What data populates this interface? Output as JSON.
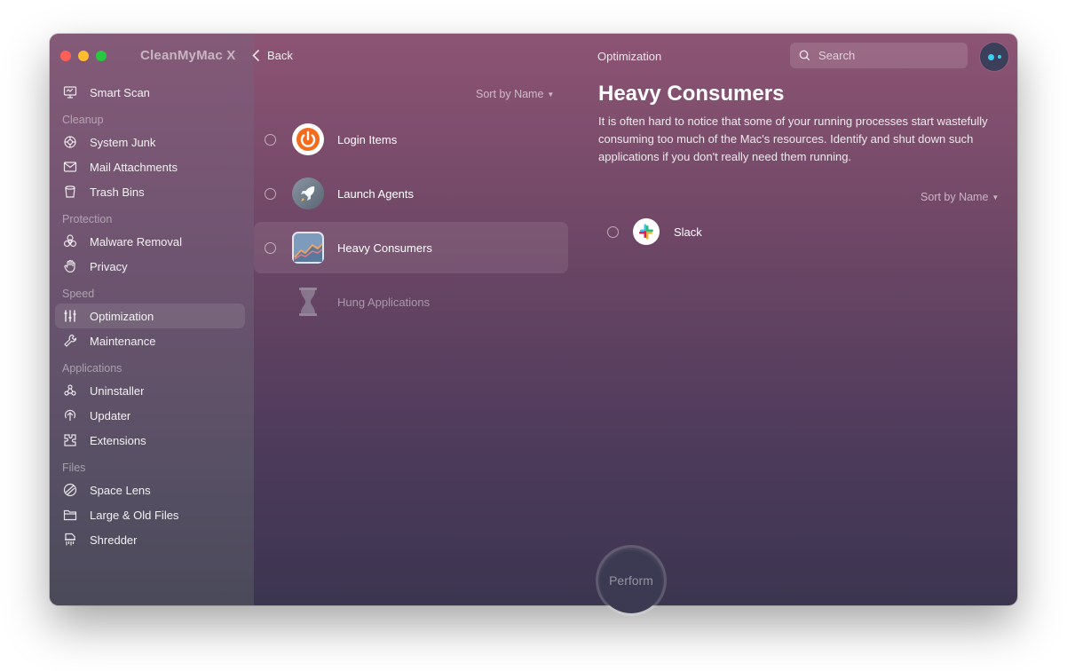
{
  "app": {
    "title": "CleanMyMac X"
  },
  "header": {
    "back_label": "Back",
    "title": "Optimization"
  },
  "search": {
    "placeholder": "Search"
  },
  "sidebar": {
    "top_item": {
      "label": "Smart Scan",
      "icon": "monitor-scan-icon"
    },
    "sections": [
      {
        "title": "Cleanup",
        "items": [
          {
            "label": "System Junk",
            "icon": "system-junk-icon"
          },
          {
            "label": "Mail Attachments",
            "icon": "mail-icon"
          },
          {
            "label": "Trash Bins",
            "icon": "trash-icon"
          }
        ]
      },
      {
        "title": "Protection",
        "items": [
          {
            "label": "Malware Removal",
            "icon": "biohazard-icon"
          },
          {
            "label": "Privacy",
            "icon": "hand-icon"
          }
        ]
      },
      {
        "title": "Speed",
        "items": [
          {
            "label": "Optimization",
            "icon": "sliders-icon",
            "active": true
          },
          {
            "label": "Maintenance",
            "icon": "wrench-icon"
          }
        ]
      },
      {
        "title": "Applications",
        "items": [
          {
            "label": "Uninstaller",
            "icon": "uninstaller-icon"
          },
          {
            "label": "Updater",
            "icon": "updater-icon"
          },
          {
            "label": "Extensions",
            "icon": "extensions-icon"
          }
        ]
      },
      {
        "title": "Files",
        "items": [
          {
            "label": "Space Lens",
            "icon": "space-lens-icon"
          },
          {
            "label": "Large & Old Files",
            "icon": "folder-icon"
          },
          {
            "label": "Shredder",
            "icon": "shredder-icon"
          }
        ]
      }
    ]
  },
  "list": {
    "sort_label": "Sort by Name",
    "items": [
      {
        "label": "Login Items",
        "icon": "power-icon"
      },
      {
        "label": "Launch Agents",
        "icon": "rocket-icon"
      },
      {
        "label": "Heavy Consumers",
        "icon": "chart-icon",
        "selected": true
      },
      {
        "label": "Hung Applications",
        "icon": "hourglass-icon",
        "disabled": true
      }
    ]
  },
  "detail": {
    "title": "Heavy Consumers",
    "description": "It is often hard to notice that some of your running processes start wastefully consuming too much of the Mac's resources. Identify and shut down such applications if you don't really need them running.",
    "sort_label": "Sort by Name",
    "apps": [
      {
        "label": "Slack",
        "icon": "slack-icon"
      }
    ]
  },
  "actions": {
    "perform_label": "Perform"
  },
  "colors": {
    "accent_dot": "#3ad1f5",
    "power_orange": "#f36b1c"
  }
}
